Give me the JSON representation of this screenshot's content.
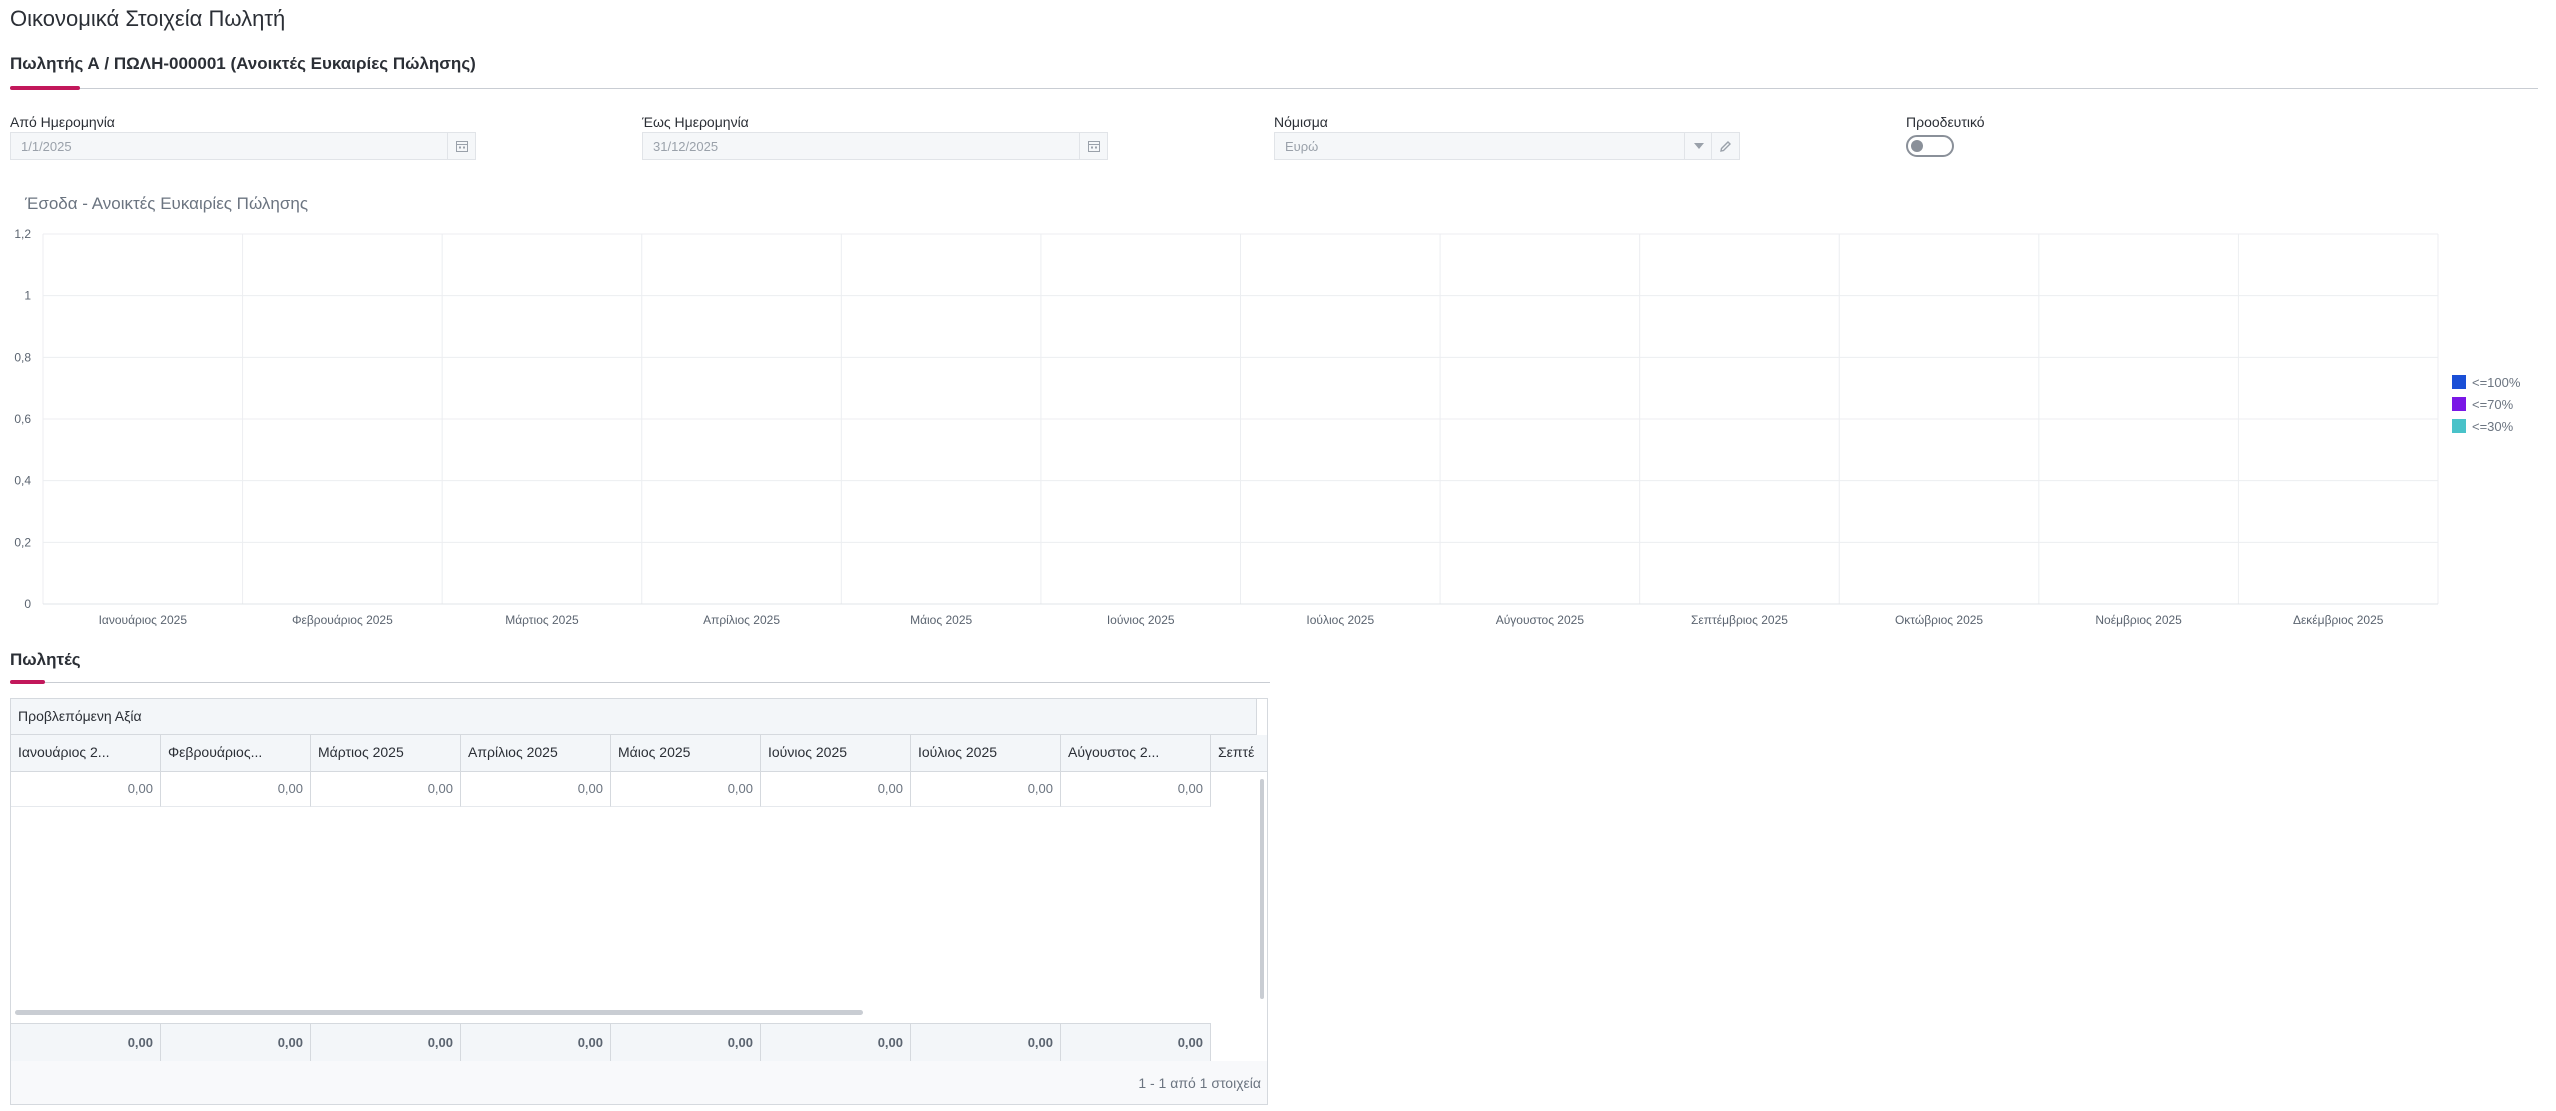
{
  "page": {
    "title": "Οικονομικά Στοιχεία Πωλητή"
  },
  "header_section": {
    "title": "Πωλητής Α / ΠΩΛΗ-000001 (Ανοικτές Ευκαιρίες Πώλησης)"
  },
  "filters": {
    "from_date": {
      "label": "Από Ημερομηνία",
      "value": "1/1/2025",
      "icon": "calendar-icon"
    },
    "to_date": {
      "label": "Έως Ημερομηνία",
      "value": "31/12/2025",
      "icon": "calendar-icon"
    },
    "currency": {
      "label": "Νόμισμα",
      "value": "Ευρώ",
      "icons": [
        "chevron-down-icon",
        "pencil-icon"
      ]
    },
    "progressive": {
      "label": "Προοδευτικό",
      "checked": false
    }
  },
  "chart_data": {
    "type": "bar",
    "title": "Έσοδα - Ανοικτές  Ευκαιρίες Πώλησης",
    "categories": [
      "Ιανουάριος 2025",
      "Φεβρουάριος 2025",
      "Μάρτιος 2025",
      "Απρίλιος 2025",
      "Μάιος 2025",
      "Ιούνιος 2025",
      "Ιούλιος 2025",
      "Αύγουστος 2025",
      "Σεπτέμβριος 2025",
      "Οκτώβριος 2025",
      "Νοέμβριος 2025",
      "Δεκέμβριος 2025"
    ],
    "series": [
      {
        "name": "<=100%",
        "color": "#1a4fd6",
        "values": [
          0,
          0,
          0,
          0,
          0,
          0,
          0,
          0,
          0,
          0,
          0,
          0
        ]
      },
      {
        "name": "<=70%",
        "color": "#7a17e6",
        "values": [
          0,
          0,
          0,
          0,
          0,
          0,
          0,
          0,
          0,
          0,
          0,
          0
        ]
      },
      {
        "name": "<=30%",
        "color": "#49c2c9",
        "values": [
          0,
          0,
          0,
          0,
          0,
          0,
          0,
          0,
          0,
          0,
          0,
          0
        ]
      }
    ],
    "y_ticks": [
      "1,2",
      "1",
      "0,8",
      "0,6",
      "0,4",
      "0,2",
      "0"
    ],
    "ylim": [
      0,
      1.2
    ],
    "grid": true,
    "legend_position": "right"
  },
  "sellers_section": {
    "title": "Πωλητές"
  },
  "grid": {
    "group_header": "Προβλεπόμενη Αξία",
    "columns": [
      "Ιανουάριος 2...",
      "Φεβρουάριος...",
      "Μάρτιος 2025",
      "Απρίλιος 2025",
      "Μάιος 2025",
      "Ιούνιος 2025",
      "Ιούλιος 2025",
      "Αύγουστος 2...",
      "Σεπτέ"
    ],
    "rows": [
      [
        "0,00",
        "0,00",
        "0,00",
        "0,00",
        "0,00",
        "0,00",
        "0,00",
        "0,00"
      ]
    ],
    "totals": [
      "0,00",
      "0,00",
      "0,00",
      "0,00",
      "0,00",
      "0,00",
      "0,00",
      "0,00"
    ],
    "pager_info": "1 - 1 από 1 στοιχεία"
  }
}
